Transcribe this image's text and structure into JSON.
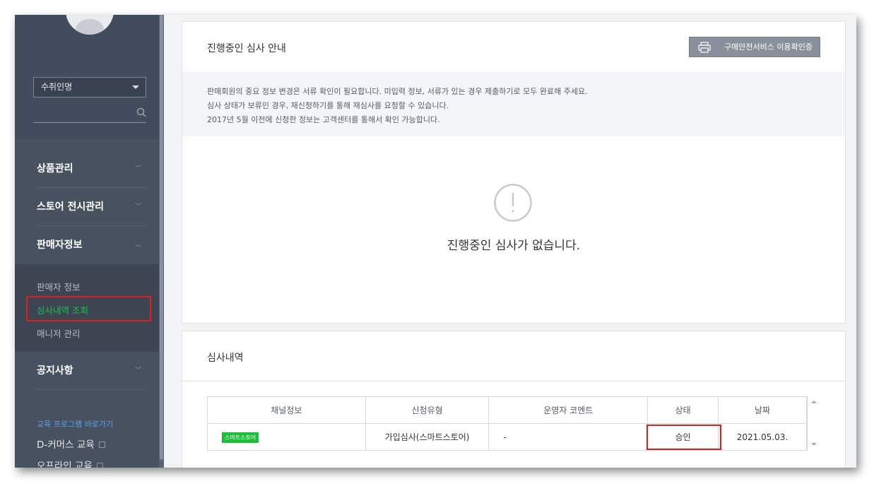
{
  "sidebar": {
    "select_value": "수취인명",
    "menu": [
      {
        "label": "상품관리",
        "chevron": "﹀"
      },
      {
        "label": "스토어 전시관리",
        "chevron": "﹀"
      },
      {
        "label": "판매자정보",
        "chevron": "︿"
      },
      {
        "label": "공지사항",
        "chevron": "﹀"
      }
    ],
    "submenu": [
      "판매자 정보",
      "심사내역 조회",
      "매니저 관리"
    ],
    "edu_link": "교육 프로그램 바로가기",
    "edu_items": [
      "D-커머스 교육",
      "오프라인 교육"
    ],
    "active_color": "#19c24a",
    "bg_color": "#434c5c"
  },
  "review_notice": {
    "title": "진행중인 심사 안내",
    "print_button": "구매안전서비스 이용확인증",
    "lines": [
      "판매회원의 중요 정보 변경은 서류 확인이 필요합니다. 미입력 정보, 서류가 있는 경우 제출하기로 모두 완료해 주세요.",
      "심사 상태가 보류인 경우, 재신청하기를 통해 재심사를 요청할 수 있습니다.",
      "2017년 5월 이전에 신청한 정보는 고객센터를 통해서 확인 가능합니다."
    ],
    "empty_message": "진행중인 심사가 없습니다."
  },
  "history": {
    "title": "심사내역",
    "columns": [
      "채널정보",
      "신청유형",
      "운영자 코멘트",
      "상태",
      "날짜"
    ],
    "rows": [
      {
        "channel_badge": "스마트스토어",
        "type": "가입심사(스마트스토어)",
        "comment": "-",
        "status": "승인",
        "date": "2021.05.03."
      }
    ],
    "badge_color": "#1bbf3a",
    "status_color": "#2d6fd0"
  }
}
